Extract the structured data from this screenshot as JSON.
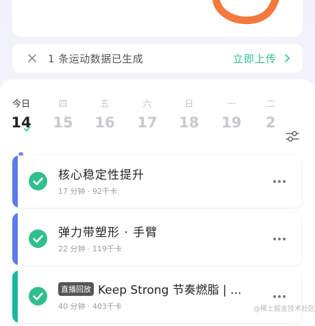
{
  "colors": {
    "accent_green": "#2fbf8c",
    "ring_orange": "#f27a3f",
    "today_dot": "#8b7cf2",
    "bar_blue": "#5b7bef",
    "bar_teal": "#16b79f"
  },
  "notice": {
    "close_icon": "close-icon",
    "message": "1 条运动数据已生成",
    "action_label": "立即上传",
    "action_icon": "chevron-right-icon"
  },
  "calendar": {
    "days": [
      {
        "weekday": "今日",
        "date": "14"
      },
      {
        "weekday": "四",
        "date": "15"
      },
      {
        "weekday": "五",
        "date": "16"
      },
      {
        "weekday": "六",
        "date": "17"
      },
      {
        "weekday": "日",
        "date": "18"
      },
      {
        "weekday": "一",
        "date": "19"
      },
      {
        "weekday": "二",
        "date": "2"
      }
    ],
    "filter_icon": "filter-sliders-icon"
  },
  "activities": [
    {
      "title": "核心稳定性提升",
      "meta": "17 分钟 · 92千卡"
    },
    {
      "title": "弹力带塑形 · 手臂",
      "meta": "22 分钟 · 119千卡"
    },
    {
      "badge": "直播回放",
      "title": "Keep Strong 节奏燃脂 | ...",
      "meta": "40 分钟 · 403千卡"
    }
  ],
  "watermark": "@稀土掘金技术社区"
}
